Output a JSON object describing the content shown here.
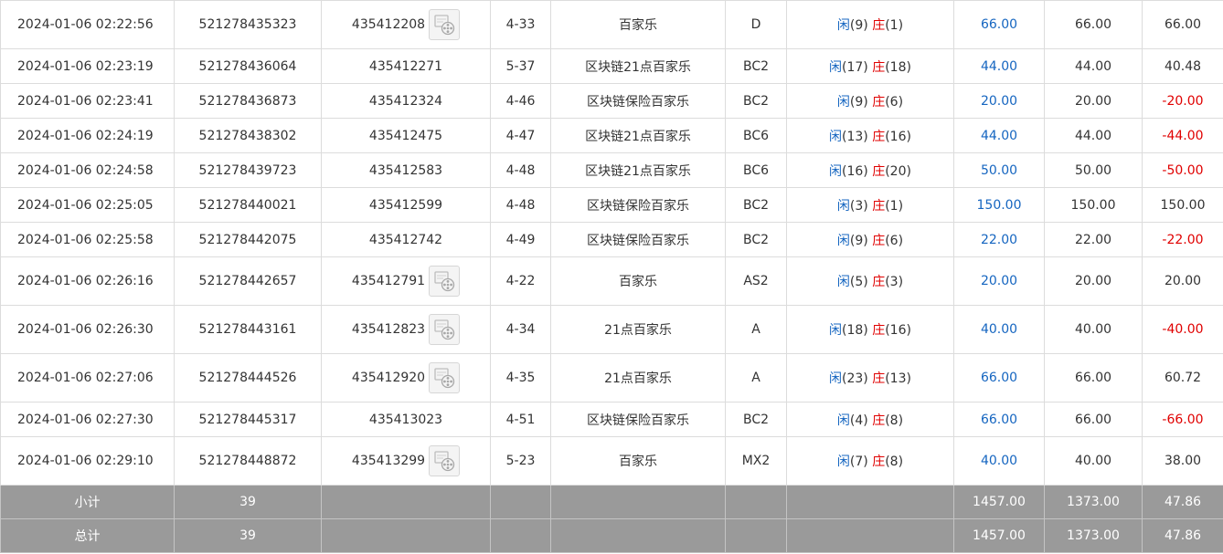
{
  "colors": {
    "bet": "#1565c0",
    "negative": "#e00000",
    "player": "#1565c0",
    "banker": "#e00000",
    "summary_bg": "#9a9a9a"
  },
  "icons": {
    "video": "video-reel-icon"
  },
  "rows": [
    {
      "time": "2024-01-06 02:22:56",
      "order": "521278435323",
      "round": "435412208",
      "video": true,
      "table": "4-33",
      "game": "百家乐",
      "seat": "D",
      "xian": "闲",
      "xv": "(9)",
      "zhuang": "庄",
      "zv": "(1)",
      "bet": "66.00",
      "valid": "66.00",
      "result": "66.00",
      "neg": false
    },
    {
      "time": "2024-01-06 02:23:19",
      "order": "521278436064",
      "round": "435412271",
      "video": false,
      "table": "5-37",
      "game": "区块链21点百家乐",
      "seat": "BC2",
      "xian": "闲",
      "xv": "(17)",
      "zhuang": "庄",
      "zv": "(18)",
      "bet": "44.00",
      "valid": "44.00",
      "result": "40.48",
      "neg": false
    },
    {
      "time": "2024-01-06 02:23:41",
      "order": "521278436873",
      "round": "435412324",
      "video": false,
      "table": "4-46",
      "game": "区块链保险百家乐",
      "seat": "BC2",
      "xian": "闲",
      "xv": "(9)",
      "zhuang": "庄",
      "zv": "(6)",
      "bet": "20.00",
      "valid": "20.00",
      "result": "-20.00",
      "neg": true
    },
    {
      "time": "2024-01-06 02:24:19",
      "order": "521278438302",
      "round": "435412475",
      "video": false,
      "table": "4-47",
      "game": "区块链21点百家乐",
      "seat": "BC6",
      "xian": "闲",
      "xv": "(13)",
      "zhuang": "庄",
      "zv": "(16)",
      "bet": "44.00",
      "valid": "44.00",
      "result": "-44.00",
      "neg": true
    },
    {
      "time": "2024-01-06 02:24:58",
      "order": "521278439723",
      "round": "435412583",
      "video": false,
      "table": "4-48",
      "game": "区块链21点百家乐",
      "seat": "BC6",
      "xian": "闲",
      "xv": "(16)",
      "zhuang": "庄",
      "zv": "(20)",
      "bet": "50.00",
      "valid": "50.00",
      "result": "-50.00",
      "neg": true
    },
    {
      "time": "2024-01-06 02:25:05",
      "order": "521278440021",
      "round": "435412599",
      "video": false,
      "table": "4-48",
      "game": "区块链保险百家乐",
      "seat": "BC2",
      "xian": "闲",
      "xv": "(3)",
      "zhuang": "庄",
      "zv": "(1)",
      "bet": "150.00",
      "valid": "150.00",
      "result": "150.00",
      "neg": false
    },
    {
      "time": "2024-01-06 02:25:58",
      "order": "521278442075",
      "round": "435412742",
      "video": false,
      "table": "4-49",
      "game": "区块链保险百家乐",
      "seat": "BC2",
      "xian": "闲",
      "xv": "(9)",
      "zhuang": "庄",
      "zv": "(6)",
      "bet": "22.00",
      "valid": "22.00",
      "result": "-22.00",
      "neg": true
    },
    {
      "time": "2024-01-06 02:26:16",
      "order": "521278442657",
      "round": "435412791",
      "video": true,
      "table": "4-22",
      "game": "百家乐",
      "seat": "AS2",
      "xian": "闲",
      "xv": "(5)",
      "zhuang": "庄",
      "zv": "(3)",
      "bet": "20.00",
      "valid": "20.00",
      "result": "20.00",
      "neg": false
    },
    {
      "time": "2024-01-06 02:26:30",
      "order": "521278443161",
      "round": "435412823",
      "video": true,
      "table": "4-34",
      "game": "21点百家乐",
      "seat": "A",
      "xian": "闲",
      "xv": "(18)",
      "zhuang": "庄",
      "zv": "(16)",
      "bet": "40.00",
      "valid": "40.00",
      "result": "-40.00",
      "neg": true
    },
    {
      "time": "2024-01-06 02:27:06",
      "order": "521278444526",
      "round": "435412920",
      "video": true,
      "table": "4-35",
      "game": "21点百家乐",
      "seat": "A",
      "xian": "闲",
      "xv": "(23)",
      "zhuang": "庄",
      "zv": "(13)",
      "bet": "66.00",
      "valid": "66.00",
      "result": "60.72",
      "neg": false
    },
    {
      "time": "2024-01-06 02:27:30",
      "order": "521278445317",
      "round": "435413023",
      "video": false,
      "table": "4-51",
      "game": "区块链保险百家乐",
      "seat": "BC2",
      "xian": "闲",
      "xv": "(4)",
      "zhuang": "庄",
      "zv": "(8)",
      "bet": "66.00",
      "valid": "66.00",
      "result": "-66.00",
      "neg": true
    },
    {
      "time": "2024-01-06 02:29:10",
      "order": "521278448872",
      "round": "435413299",
      "video": true,
      "table": "5-23",
      "game": "百家乐",
      "seat": "MX2",
      "xian": "闲",
      "xv": "(7)",
      "zhuang": "庄",
      "zv": "(8)",
      "bet": "40.00",
      "valid": "40.00",
      "result": "38.00",
      "neg": false
    }
  ],
  "subtotal": {
    "label": "小计",
    "count": "39",
    "bet": "1457.00",
    "valid": "1373.00",
    "result": "47.86"
  },
  "total": {
    "label": "总计",
    "count": "39",
    "bet": "1457.00",
    "valid": "1373.00",
    "result": "47.86"
  }
}
